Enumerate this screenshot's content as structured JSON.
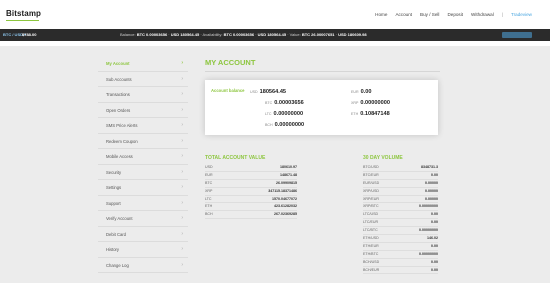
{
  "header": {
    "logo": "Bitstamp",
    "nav": [
      "Home",
      "Account",
      "Buy / Sell",
      "Deposit",
      "Withdrawal"
    ],
    "separator": "|",
    "nav_accent": "Tradeview"
  },
  "ticker": {
    "pair": "BTC / USD",
    "price": "$788.00",
    "balance_label": "Balance:",
    "balance_btc": "BTC 0.00003656",
    "balance_usd": "USD 180564.45",
    "availability_label": "Availability:",
    "avail_btc": "BTC 0.00003656",
    "avail_usd": "USD 180564.45",
    "value_label": "Value:",
    "value_btc": "BTC 26.00007651",
    "value_usd": "USD 180609.98"
  },
  "sidebar": {
    "items": [
      {
        "label": "My Account",
        "active": true
      },
      {
        "label": "Sub Accounts"
      },
      {
        "label": "Transactions"
      },
      {
        "label": "Open Orders"
      },
      {
        "label": "SMS Price Alerts"
      },
      {
        "label": "Redeem Coupon"
      },
      {
        "label": "Mobile Access"
      },
      {
        "label": "Security"
      },
      {
        "label": "Settings"
      },
      {
        "label": "Support"
      },
      {
        "label": "Verify Account"
      },
      {
        "label": "Debit Card"
      },
      {
        "label": "History"
      },
      {
        "label": "Change Log"
      }
    ],
    "chevron": "›"
  },
  "main": {
    "title": "MY ACCOUNT",
    "balance_label": "Account balance",
    "balances_left": [
      {
        "cur": "USD",
        "val": "180564.45"
      },
      {
        "cur": "BTC",
        "val": "0.00003656"
      },
      {
        "cur": "LTC",
        "val": "0.00000000"
      },
      {
        "cur": "BCH",
        "val": "0.00000000"
      }
    ],
    "balances_right": [
      {
        "cur": "EUR",
        "val": "0.00"
      },
      {
        "cur": "XRP",
        "val": "0.00000000"
      },
      {
        "cur": "ETH",
        "val": "0.10847148"
      }
    ],
    "total_title": "TOTAL ACCOUNT VALUE",
    "total_rows": [
      {
        "k": "USD",
        "v": "180610.97"
      },
      {
        "k": "EUR",
        "v": "148671.48"
      },
      {
        "k": "BTC",
        "v": "26.09909815"
      },
      {
        "k": "XRP",
        "v": "347115.18371486"
      },
      {
        "k": "LTC",
        "v": "1570.04677072"
      },
      {
        "k": "ETH",
        "v": "423.61282032"
      },
      {
        "k": "BCH",
        "v": "267.02369285"
      }
    ],
    "volume_title": "30 DAY VOLUME",
    "volume_rows": [
      {
        "k": "BTC/USD",
        "v": "8348731.3"
      },
      {
        "k": "BTC/EUR",
        "v": "0.00"
      },
      {
        "k": "EUR/USD",
        "v": "0.00000"
      },
      {
        "k": "XRP/USD",
        "v": "0.00000"
      },
      {
        "k": "XRP/EUR",
        "v": "0.00000"
      },
      {
        "k": "XRP/BTC",
        "v": "0.00000000"
      },
      {
        "k": "LTC/USD",
        "v": "0.00"
      },
      {
        "k": "LTC/EUR",
        "v": "0.00"
      },
      {
        "k": "LTC/BTC",
        "v": "0.00000000"
      },
      {
        "k": "ETH/USD",
        "v": "146.02"
      },
      {
        "k": "ETH/EUR",
        "v": "0.00"
      },
      {
        "k": "ETH/BTC",
        "v": "0.00000000"
      },
      {
        "k": "BCH/USD",
        "v": "0.00"
      },
      {
        "k": "BCH/EUR",
        "v": "0.00"
      }
    ]
  },
  "colors": {
    "accent": "#8dc63f",
    "ticker_bg": "#2b2b2b",
    "link": "#4aa6e0"
  }
}
